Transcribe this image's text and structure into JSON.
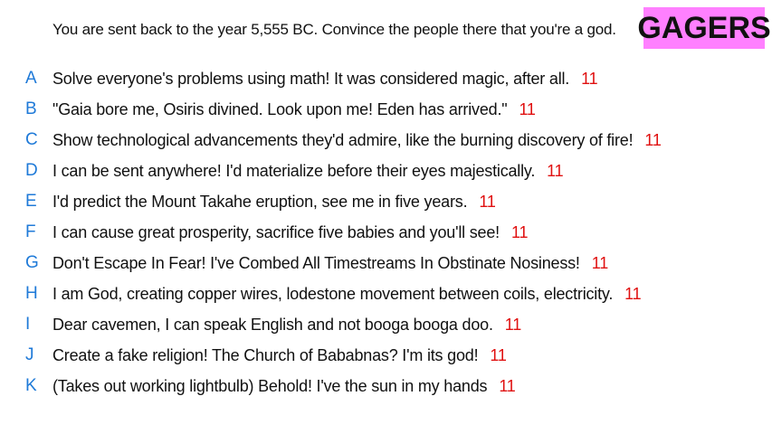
{
  "brand": "GAGERS",
  "prompt": "You are sent back to the year 5,555 BC. Convince the people there that you're a god.",
  "colors": {
    "letter": "#1f7ad8",
    "score": "#e01010",
    "brand_bg": "#ff80ff"
  },
  "answers": [
    {
      "letter": "A",
      "text": "Solve everyone's problems using math! It was considered magic, after all.",
      "score": "11"
    },
    {
      "letter": "B",
      "text": "\"Gaia bore me, Osiris divined. Look upon me! Eden has arrived.\"",
      "score": "11"
    },
    {
      "letter": "C",
      "text": "Show technological advancements they'd admire, like the burning discovery of fire!",
      "score": "11"
    },
    {
      "letter": "D",
      "text": "I can be sent anywhere! I'd materialize before their eyes majestically.",
      "score": "11"
    },
    {
      "letter": "E",
      "text": "I'd predict the Mount Takahe eruption, see me in five years.",
      "score": "11"
    },
    {
      "letter": "F",
      "text": "I can cause great prosperity, sacrifice five babies and you'll see!",
      "score": "11"
    },
    {
      "letter": "G",
      "text": "Don't Escape In Fear! I've Combed All Timestreams In Obstinate Nosiness!",
      "score": "11"
    },
    {
      "letter": "H",
      "text": "I am God, creating copper wires, lodestone movement between coils, electricity.",
      "score": "11"
    },
    {
      "letter": "I",
      "text": "Dear cavemen, I can speak English and not booga booga doo.",
      "score": "11"
    },
    {
      "letter": "J",
      "text": "Create a fake religion! The Church of Bababnas? I'm its god!",
      "score": "11"
    },
    {
      "letter": "K",
      "text": "(Takes out working lightbulb) Behold! I've the sun in my hands",
      "score": "11"
    }
  ]
}
